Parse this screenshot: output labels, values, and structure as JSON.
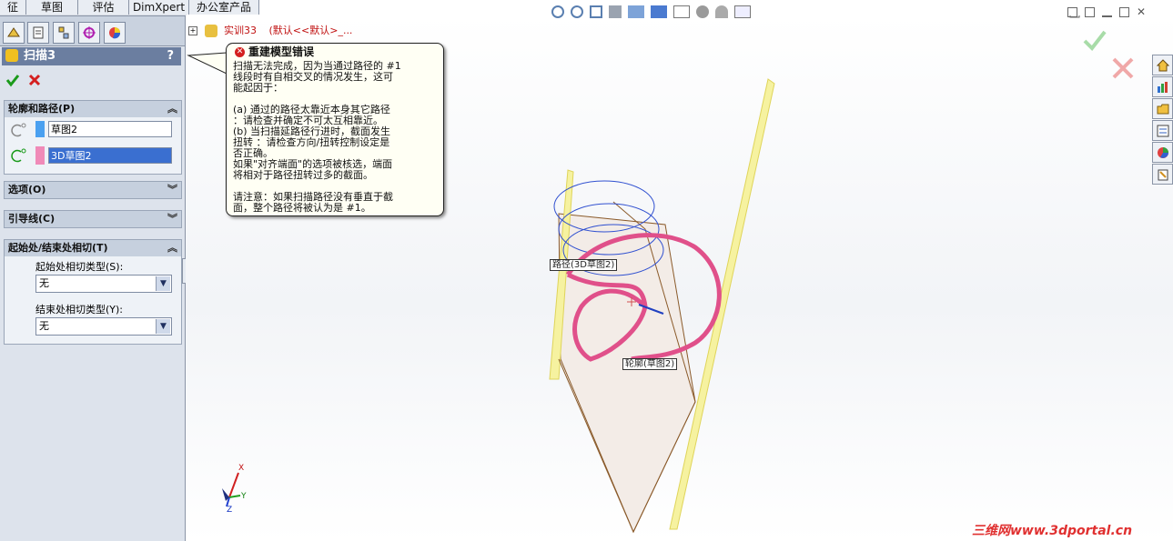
{
  "top_tabs": [
    "征",
    "草图",
    "评估",
    "DimXpert",
    "办公室产品"
  ],
  "property_manager": {
    "title": "扫描3",
    "help": "?",
    "sections": {
      "profile_path": {
        "title": "轮廓和路径(P)",
        "profile_value": "草图2",
        "path_value": "3D草图2"
      },
      "options": {
        "title": "选项(O)"
      },
      "guides": {
        "title": "引导线(C)"
      },
      "tangency": {
        "title": "起始处/结束处相切(T)",
        "start_label": "起始处相切类型(S):",
        "start_value": "无",
        "end_label": "结束处相切类型(Y):",
        "end_value": "无"
      }
    }
  },
  "tree": {
    "part_name": "实训33",
    "config": "(默认<<默认>_..."
  },
  "error_balloon": {
    "title": "重建模型错误",
    "lines": [
      "扫描无法完成，因为当通过路径的 #1",
      "线段时有自相交叉的情况发生，这可",
      "能起因于：",
      "",
      "(a) 通过的路径太靠近本身其它路径",
      "：请检查并确定不可太互相靠近。",
      "(b) 当扫描延路径行进时，截面发生",
      "扭转 ：请检查方向/扭转控制设定是",
      "否正确。",
      "如果\"对齐端面\"的选项被核选，端面",
      "将相对于路径扭转过多的截面。",
      "",
      "请注意：如果扫描路径没有垂直于截",
      "面，整个路径将被认为是 #1。"
    ]
  },
  "callouts": {
    "path": "路径(3D草图2)",
    "profile": "轮廓(草图2)"
  },
  "triad": {
    "x": "X",
    "y": "Y",
    "z": "Z"
  },
  "watermark": "三维网www.3dportal.cn",
  "colors": {
    "accent": "#6b7ea0",
    "sweep": "#e0508a",
    "error": "#d42020",
    "ok": "#1a9a1a"
  }
}
